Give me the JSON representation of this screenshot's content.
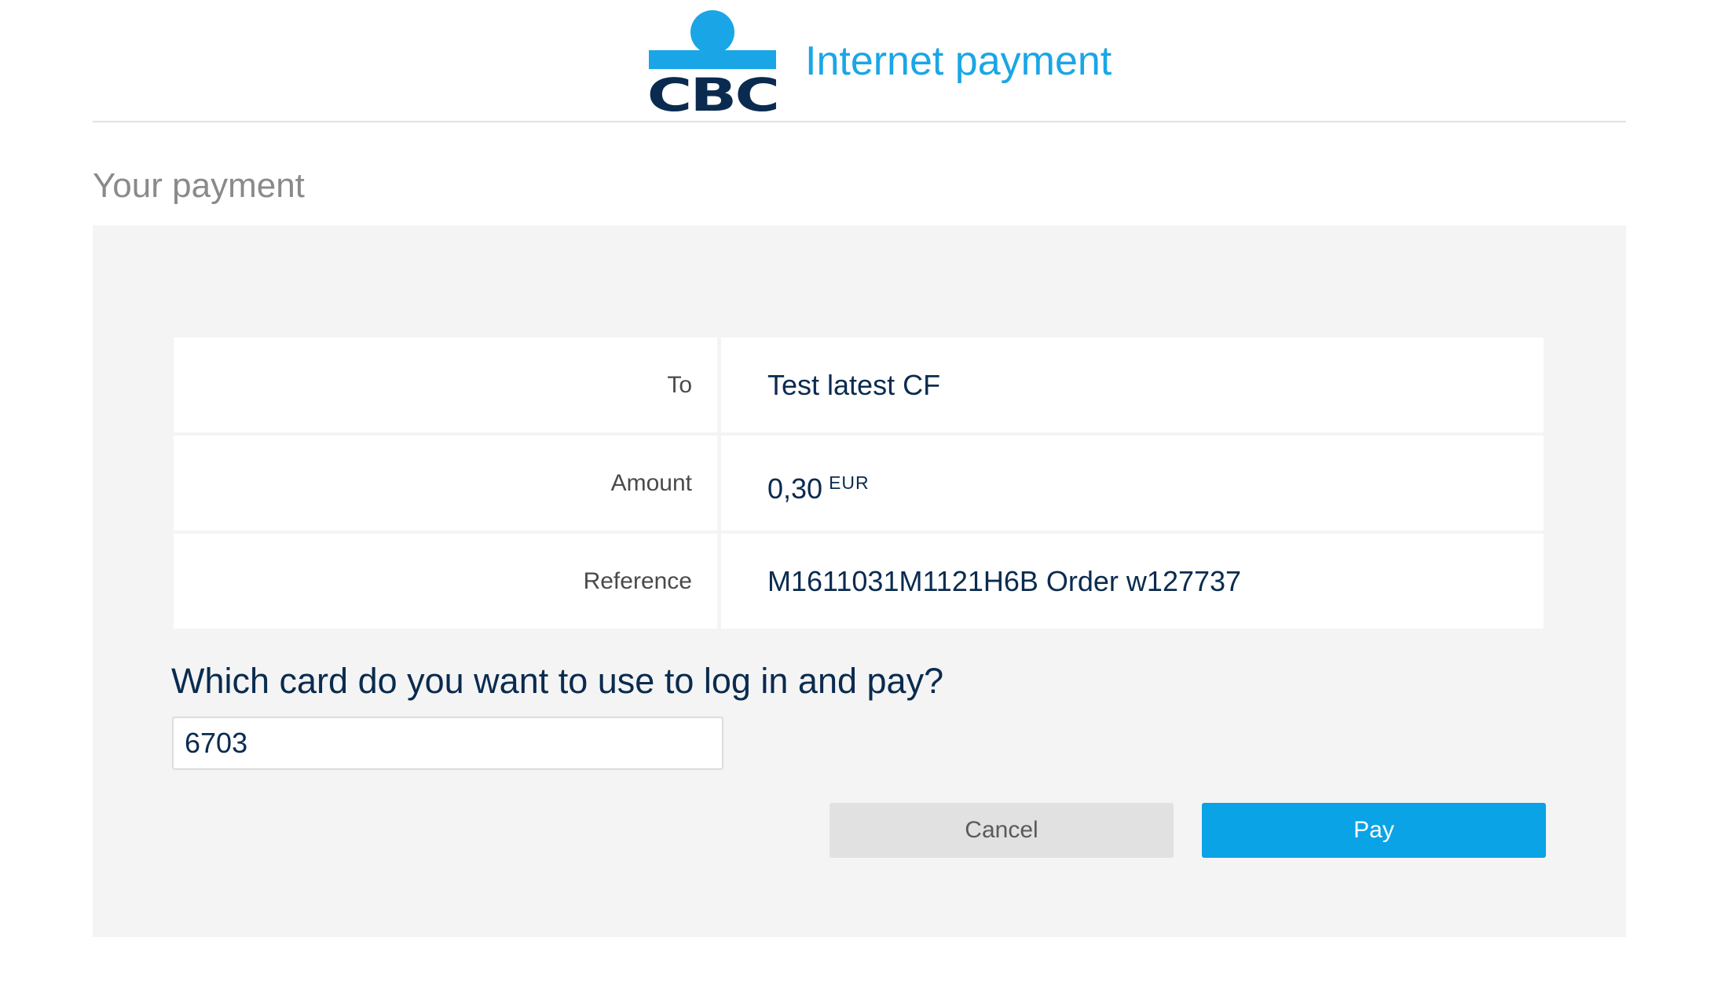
{
  "header": {
    "logo_text": "CBC",
    "title": "Internet payment"
  },
  "section_title": "Your payment",
  "details": [
    {
      "label": "To",
      "value": "Test latest CF"
    },
    {
      "label": "Amount",
      "value": "0,30",
      "currency": "EUR"
    },
    {
      "label": "Reference",
      "value": "M1611031M1121H6B Order w127737"
    }
  ],
  "card": {
    "question": "Which card do you want to use to log in and pay?",
    "input_value": "6703"
  },
  "buttons": {
    "cancel_label": "Cancel",
    "pay_label": "Pay"
  },
  "colors": {
    "brand_blue": "#1aa6e6",
    "navy": "#0a2b4f",
    "pay_button": "#0aa3e6",
    "cancel_button": "#e1e1e1",
    "panel_background": "#f4f4f4"
  }
}
